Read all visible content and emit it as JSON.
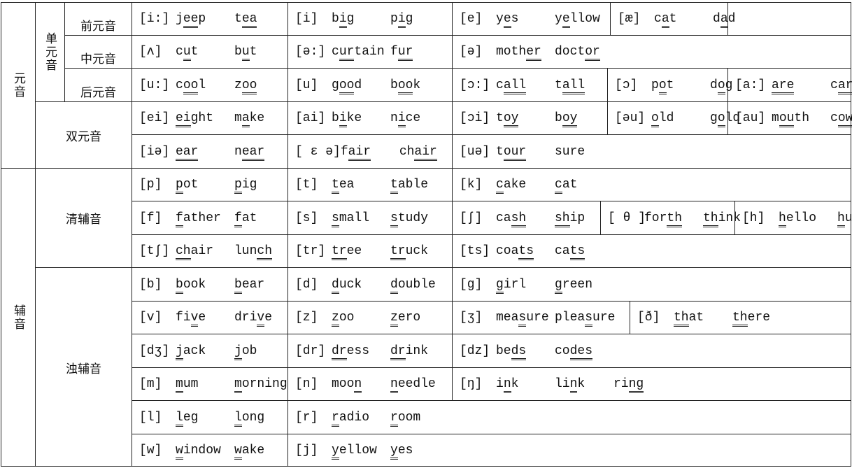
{
  "labels": {
    "vowel": "元音",
    "monophthong": "单元音",
    "front": "前元音",
    "central": "中元音",
    "back": "后元音",
    "diphthong": "双元音",
    "consonant": "辅音",
    "voiceless": "清辅音",
    "voiced": "浊辅音"
  },
  "rows": [
    [
      {
        "ipa": "[i:]",
        "words": [
          [
            "j",
            "ee",
            "p"
          ],
          [
            "t",
            "ea",
            ""
          ]
        ]
      },
      {
        "ipa": "[i]",
        "words": [
          [
            "b",
            "i",
            "g"
          ],
          [
            "p",
            "i",
            "g"
          ]
        ]
      },
      {
        "ipa": "[e]",
        "words": [
          [
            "y",
            "e",
            "s"
          ],
          [
            "y",
            "e",
            "llow"
          ]
        ]
      },
      {
        "ipa": "[æ]",
        "words": [
          [
            "c",
            "a",
            "t"
          ],
          [
            "d",
            "a",
            "d"
          ]
        ]
      },
      {
        "ipa": "",
        "words": []
      }
    ],
    [
      {
        "ipa": "[ʌ]",
        "words": [
          [
            "c",
            "u",
            "t"
          ],
          [
            "b",
            "u",
            "t"
          ]
        ]
      },
      {
        "ipa": "[ə:]",
        "words": [
          [
            "c",
            "ur",
            "tain"
          ],
          [
            "f",
            "ur",
            ""
          ]
        ]
      },
      {
        "ipa": "[ə]",
        "words": [
          [
            "moth",
            "er",
            ""
          ],
          [
            "doct",
            "or",
            ""
          ]
        ]
      }
    ],
    [
      {
        "ipa": "[u:]",
        "words": [
          [
            "c",
            "oo",
            "l"
          ],
          [
            "z",
            "oo",
            ""
          ]
        ]
      },
      {
        "ipa": "[u]",
        "words": [
          [
            "g",
            "oo",
            "d"
          ],
          [
            "b",
            "oo",
            "k"
          ]
        ]
      },
      {
        "ipa": "[ɔ:]",
        "words": [
          [
            "c",
            "all",
            ""
          ],
          [
            "t",
            "all",
            ""
          ]
        ]
      },
      {
        "ipa": "[ɔ]",
        "words": [
          [
            "p",
            "o",
            "t"
          ],
          [
            "d",
            "o",
            "g"
          ]
        ]
      },
      {
        "ipa": "[a:]",
        "words": [
          [
            "",
            "are",
            ""
          ],
          [
            "c",
            "ar",
            ""
          ]
        ]
      }
    ],
    [
      {
        "ipa": "[ei]",
        "words": [
          [
            "",
            "ei",
            "ght"
          ],
          [
            "m",
            "a",
            "ke"
          ]
        ]
      },
      {
        "ipa": "[ai]",
        "words": [
          [
            "b",
            "i",
            "ke"
          ],
          [
            "n",
            "i",
            "ce"
          ]
        ]
      },
      {
        "ipa": "[ɔi]",
        "words": [
          [
            "t",
            "oy",
            ""
          ],
          [
            "b",
            "oy",
            ""
          ]
        ]
      },
      {
        "ipa": "[əu]",
        "words": [
          [
            "",
            "o",
            "ld"
          ],
          [
            "g",
            "o",
            "ld"
          ]
        ]
      },
      {
        "ipa": "[au]",
        "words": [
          [
            "m",
            "ou",
            "th"
          ],
          [
            "c",
            "ow",
            ""
          ]
        ]
      }
    ],
    [
      {
        "ipa": "[iə]",
        "words": [
          [
            "",
            "ear",
            ""
          ],
          [
            "n",
            "ear",
            ""
          ]
        ]
      },
      {
        "ipa": "[ ε ə]",
        "words": [
          [
            "f",
            "air",
            ""
          ],
          [
            "ch",
            "air",
            ""
          ]
        ]
      },
      {
        "ipa": "[uə]",
        "words": [
          [
            "t",
            "our",
            ""
          ],
          [
            "sure",
            "",
            ""
          ]
        ]
      }
    ],
    [
      {
        "ipa": "[p]",
        "words": [
          [
            "",
            "p",
            "ot"
          ],
          [
            "",
            "p",
            "ig"
          ]
        ]
      },
      {
        "ipa": "[t]",
        "words": [
          [
            "",
            "t",
            "ea"
          ],
          [
            "",
            "t",
            "able"
          ]
        ]
      },
      {
        "ipa": "[k]",
        "words": [
          [
            "",
            "c",
            "ake"
          ],
          [
            "",
            "c",
            "at"
          ]
        ]
      }
    ],
    [
      {
        "ipa": "[f]",
        "words": [
          [
            "",
            "f",
            "ather"
          ],
          [
            "",
            "f",
            "at"
          ]
        ]
      },
      {
        "ipa": "[s]",
        "words": [
          [
            "",
            "s",
            "mall"
          ],
          [
            "",
            "s",
            "tudy"
          ]
        ]
      },
      {
        "ipa": "[ʃ]",
        "words": [
          [
            "ca",
            "sh",
            ""
          ],
          [
            "",
            "sh",
            "ip"
          ]
        ]
      },
      {
        "ipa": "[ θ ]",
        "words": [
          [
            "for",
            "th",
            ""
          ],
          [
            "",
            "th",
            "ink"
          ]
        ]
      },
      {
        "ipa": "[h]",
        "words": [
          [
            "",
            "h",
            "ello"
          ],
          [
            "",
            "h",
            "urry"
          ]
        ]
      }
    ],
    [
      {
        "ipa": "[tʃ]",
        "words": [
          [
            "",
            "ch",
            "air"
          ],
          [
            "lun",
            "ch",
            ""
          ]
        ]
      },
      {
        "ipa": "[tr]",
        "words": [
          [
            "",
            "tr",
            "ee"
          ],
          [
            "",
            "tr",
            "uck"
          ]
        ]
      },
      {
        "ipa": "[ts]",
        "words": [
          [
            "coa",
            "ts",
            ""
          ],
          [
            "ca",
            "ts",
            ""
          ]
        ]
      }
    ],
    [
      {
        "ipa": "[b]",
        "words": [
          [
            "",
            "b",
            "ook"
          ],
          [
            "",
            "b",
            "ear"
          ]
        ]
      },
      {
        "ipa": "[d]",
        "words": [
          [
            "",
            "d",
            "uck"
          ],
          [
            "",
            "d",
            "ouble"
          ]
        ]
      },
      {
        "ipa": "[g]",
        "words": [
          [
            "",
            "g",
            "irl"
          ],
          [
            "",
            "g",
            "reen"
          ]
        ]
      }
    ],
    [
      {
        "ipa": "[v]",
        "words": [
          [
            "fi",
            "v",
            "e"
          ],
          [
            "dri",
            "v",
            "e"
          ]
        ]
      },
      {
        "ipa": "[z]",
        "words": [
          [
            "",
            "z",
            "oo"
          ],
          [
            "",
            "z",
            "ero"
          ]
        ]
      },
      {
        "ipa": "[ʒ]",
        "words": [
          [
            "mea",
            "s",
            "ure"
          ],
          [
            "plea",
            "s",
            "ure"
          ]
        ]
      },
      {
        "ipa": "[ð]",
        "words": [
          [
            "",
            "th",
            "at"
          ],
          [
            "",
            "th",
            "ere"
          ]
        ]
      }
    ],
    [
      {
        "ipa": "[dʒ]",
        "words": [
          [
            "",
            "j",
            "ack"
          ],
          [
            "",
            "j",
            "ob"
          ]
        ]
      },
      {
        "ipa": "[dr]",
        "words": [
          [
            "",
            "dr",
            "ess"
          ],
          [
            "",
            "dr",
            "ink"
          ]
        ]
      },
      {
        "ipa": "[dz]",
        "words": [
          [
            "be",
            "ds",
            ""
          ],
          [
            "co",
            "des",
            ""
          ]
        ]
      }
    ],
    [
      {
        "ipa": "[m]",
        "words": [
          [
            "",
            "m",
            "um"
          ],
          [
            "",
            "m",
            "orning"
          ]
        ]
      },
      {
        "ipa": "[n]",
        "words": [
          [
            "moo",
            "n",
            ""
          ],
          [
            "",
            "n",
            "eedle"
          ]
        ]
      },
      {
        "ipa": "[ŋ]",
        "words": [
          [
            "i",
            "n",
            "k"
          ],
          [
            "li",
            "n",
            "k"
          ],
          [
            "ri",
            "ng",
            ""
          ]
        ]
      }
    ],
    [
      {
        "ipa": "[l]",
        "words": [
          [
            "",
            "l",
            "eg"
          ],
          [
            "",
            "l",
            "ong"
          ]
        ]
      },
      {
        "ipa": "[r]",
        "words": [
          [
            "",
            "r",
            "adio"
          ],
          [
            "",
            "r",
            "oom"
          ]
        ]
      }
    ],
    [
      {
        "ipa": "[w]",
        "words": [
          [
            "",
            "w",
            "indow"
          ],
          [
            "",
            "w",
            "ake"
          ]
        ]
      },
      {
        "ipa": "[j]",
        "words": [
          [
            "",
            "y",
            "ellow"
          ],
          [
            "",
            "y",
            "es"
          ]
        ]
      }
    ]
  ]
}
